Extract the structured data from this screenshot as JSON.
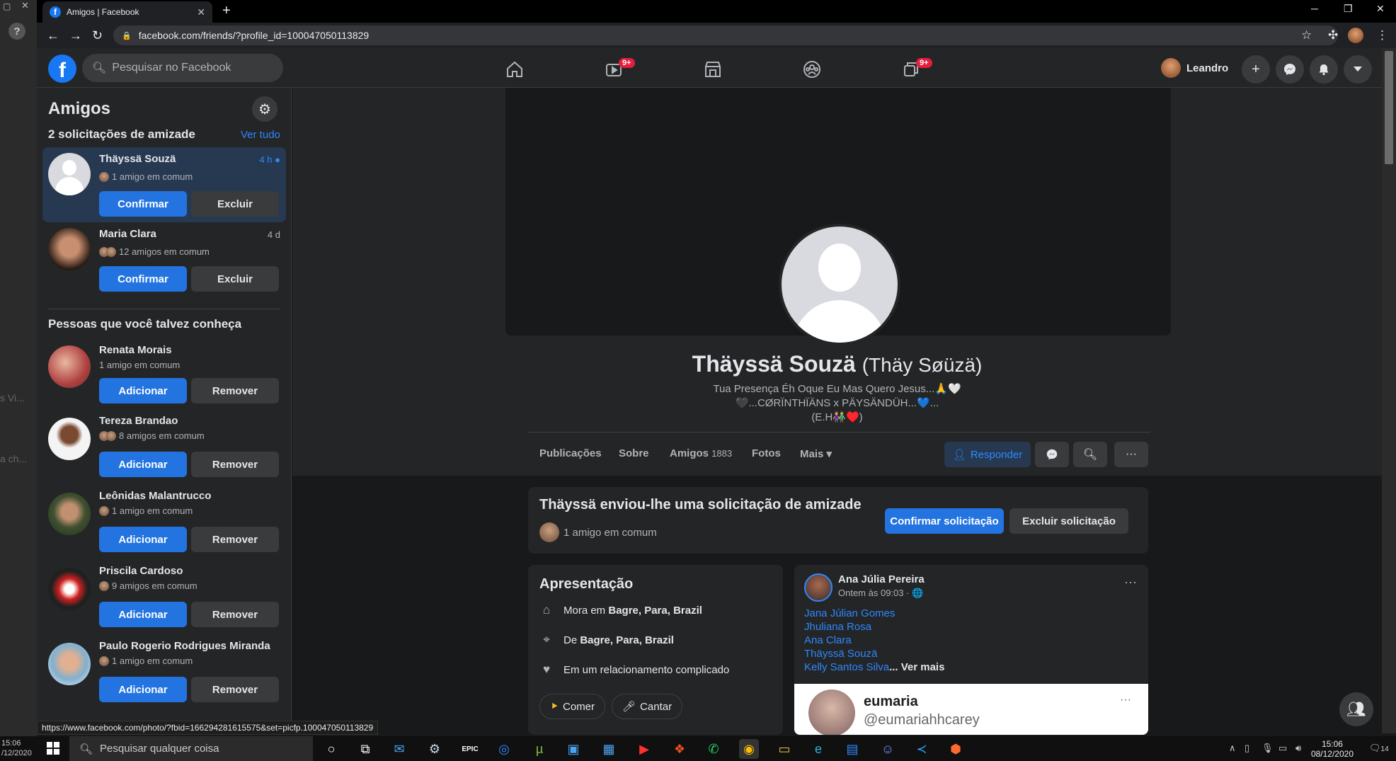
{
  "browser": {
    "tab_title": "Amigos | Facebook",
    "tab_close": "✕",
    "new_tab": "+",
    "url": "facebook.com/friends/?profile_id=100047050113829",
    "status_url": "https://www.facebook.com/photo/?fbid=166294281615575&set=picfp.100047050113829"
  },
  "left_strip": {
    "text1": "s Vi...",
    "text2": "a ch...",
    "time": "15:06",
    "date": "/12/2020"
  },
  "fb": {
    "search_placeholder": "Pesquisar no Facebook",
    "logo_letter": "f",
    "badge_watch": "9+",
    "badge_gaming": "9+",
    "user_name": "Leandro"
  },
  "sidebar": {
    "title": "Amigos",
    "requests_heading": "2 solicitações de amizade",
    "see_all": "Ver tudo",
    "requests": [
      {
        "name": "Thäyssä Souzä",
        "time": "4 h",
        "mutual": "1 amigo em comum",
        "confirm": "Confirmar",
        "delete": "Excluir"
      },
      {
        "name": "Maria Clara",
        "time": "4 d",
        "mutual": "12 amigos em comum",
        "confirm": "Confirmar",
        "delete": "Excluir"
      }
    ],
    "suggest_heading": "Pessoas que você talvez conheça",
    "suggestions": [
      {
        "name": "Renata Morais",
        "mutual": "1 amigo em comum",
        "add": "Adicionar",
        "remove": "Remover"
      },
      {
        "name": "Tereza Brandao",
        "mutual": "8 amigos em comum",
        "add": "Adicionar",
        "remove": "Remover"
      },
      {
        "name": "Leônidas Malantrucco",
        "mutual": "1 amigo em comum",
        "add": "Adicionar",
        "remove": "Remover"
      },
      {
        "name": "Priscila Cardoso",
        "mutual": "9 amigos em comum",
        "add": "Adicionar",
        "remove": "Remover"
      },
      {
        "name": "Paulo Rogerio Rodrigues Miranda",
        "mutual": "1 amigo em comum",
        "add": "Adicionar",
        "remove": "Remover"
      }
    ]
  },
  "profile": {
    "name": "Thäyssä Souzä",
    "alt_name": "(Thäy Søüzä)",
    "bio1": "Tua Presença Éh Oque Eu Mas Quero Jesus...🙏🤍",
    "bio2": "🖤...CØRÏNTHÏÄNS x PÄYSÄNDÜH...💙...",
    "bio3": "(E.H👫♥️)",
    "tabs": {
      "posts": "Publicações",
      "about": "Sobre",
      "friends": "Amigos",
      "friends_count": "1883",
      "photos": "Fotos",
      "more": "Mais ▾"
    },
    "respond": "Responder",
    "request_card": {
      "title": "Thäyssä enviou-lhe uma solicitação de amizade",
      "mutual": "1 amigo em comum",
      "confirm": "Confirmar solicitação",
      "delete": "Excluir solicitação"
    },
    "intro": {
      "title": "Apresentação",
      "lives_prefix": "Mora em ",
      "lives": "Bagre, Para, Brazil",
      "from_prefix": "De ",
      "from": "Bagre, Para, Brazil",
      "relationship": "Em um relacionamento complicado",
      "hobbies": [
        "Comer",
        "Cantar"
      ]
    },
    "post": {
      "author": "Ana Júlia Pereira",
      "time": "Ontem às 09:03 · 🌐",
      "tags": [
        "Jana Júlian Gomes",
        "Jhuliana Rosa",
        "Ana Clara",
        "Thäyssä Souzä",
        "Kelly Santos Silva"
      ],
      "see_more": "... Ver mais",
      "embed_name": "eumaria",
      "embed_handle": "@eumariahhcarey"
    }
  },
  "taskbar": {
    "search_placeholder": "Pesquisar qualquer coisa",
    "time": "15:06",
    "date": "08/12/2020",
    "notif_count": "14"
  },
  "colors": {
    "fb_blue": "#1877f2",
    "link_blue": "#2d88ff",
    "bg_dark": "#18191a",
    "surface": "#242526"
  }
}
